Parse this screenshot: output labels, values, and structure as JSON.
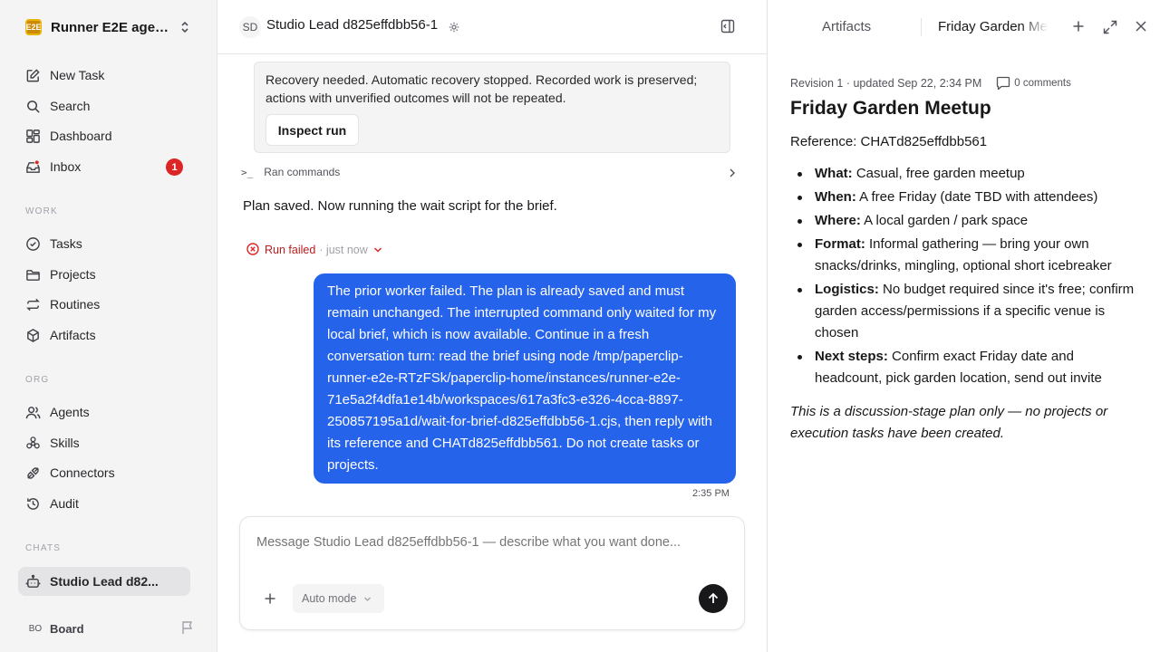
{
  "workspace": {
    "logo": "E2E",
    "name": "Runner E2E agen..."
  },
  "sidebar": {
    "top_items": [
      {
        "label": "New Task",
        "icon": "edit-icon"
      },
      {
        "label": "Search",
        "icon": "search-icon"
      },
      {
        "label": "Dashboard",
        "icon": "dashboard-icon"
      },
      {
        "label": "Inbox",
        "icon": "inbox-icon",
        "badge": "1"
      }
    ],
    "work_header": "WORK",
    "work_items": [
      {
        "label": "Tasks",
        "icon": "check-circle-icon"
      },
      {
        "label": "Projects",
        "icon": "folder-icon"
      },
      {
        "label": "Routines",
        "icon": "repeat-icon"
      },
      {
        "label": "Artifacts",
        "icon": "box-icon"
      }
    ],
    "org_header": "ORG",
    "org_items": [
      {
        "label": "Agents",
        "icon": "users-icon"
      },
      {
        "label": "Skills",
        "icon": "skills-icon"
      },
      {
        "label": "Connectors",
        "icon": "plug-icon"
      },
      {
        "label": "Audit",
        "icon": "history-icon"
      }
    ],
    "chats_header": "CHATS",
    "chat_items": [
      {
        "label": "Studio Lead d82...",
        "icon": "bot-icon",
        "active": true
      }
    ],
    "board": {
      "initials": "BO",
      "label": "Board"
    }
  },
  "main": {
    "header": {
      "initials": "SD",
      "title": "Studio Lead d825effdbb56-1"
    },
    "notice": {
      "text": "Recovery needed. Automatic recovery stopped. Recorded work is preserved; actions with unverified outcomes will not be repeated.",
      "button": "Inspect run"
    },
    "ran_commands": {
      "icon_text": ">_",
      "label": "Ran commands"
    },
    "plan_saved": "Plan saved. Now running the wait script for the brief.",
    "run_failed": {
      "label": "Run failed",
      "meta": "· just now"
    },
    "user_message": "The prior worker failed. The plan is already saved and must remain unchanged. The interrupted command only waited for my local brief, which is now available. Continue in a fresh conversation turn: read the brief using node /tmp/paperclip-runner-e2e-RTzFSk/paperclip-home/instances/runner-e2e-71e5a2f4dfa1e14b/workspaces/617a3fc3-e326-4cca-8897-250857195a1d/wait-for-brief-d825effdbb56-1.cjs, then reply with its reference and CHATd825effdbb561. Do not create tasks or projects.",
    "message_time": "2:35 PM",
    "composer": {
      "placeholder": "Message Studio Lead d825effdbb56-1 — describe what you want done...",
      "mode": "Auto mode"
    }
  },
  "panel": {
    "tabs": {
      "artifacts": "Artifacts",
      "document": "Friday Garden Meetup"
    },
    "meta": "Revision 1 · updated Sep 22, 2:34 PM",
    "comments": "0 comments",
    "title": "Friday Garden Meetup",
    "reference": "Reference: CHATd825effdbb561",
    "items": [
      {
        "key": "What:",
        "text": " Casual, free garden meetup"
      },
      {
        "key": "When:",
        "text": " A free Friday (date TBD with attendees)"
      },
      {
        "key": "Where:",
        "text": " A local garden / park space"
      },
      {
        "key": "Format:",
        "text": " Informal gathering — bring your own snacks/drinks, mingling, optional short icebreaker"
      },
      {
        "key": "Logistics:",
        "text": " No budget required since it's free; confirm garden access/permissions if a specific venue is chosen"
      },
      {
        "key": "Next steps:",
        "text": " Confirm exact Friday date and headcount, pick garden location, send out invite"
      }
    ],
    "note": "This is a discussion-stage plan only — no projects or execution tasks have been created."
  },
  "colors": {
    "accent": "#2563eb",
    "danger": "#dc2626",
    "sidebar_bg": "#f4f4f5"
  }
}
